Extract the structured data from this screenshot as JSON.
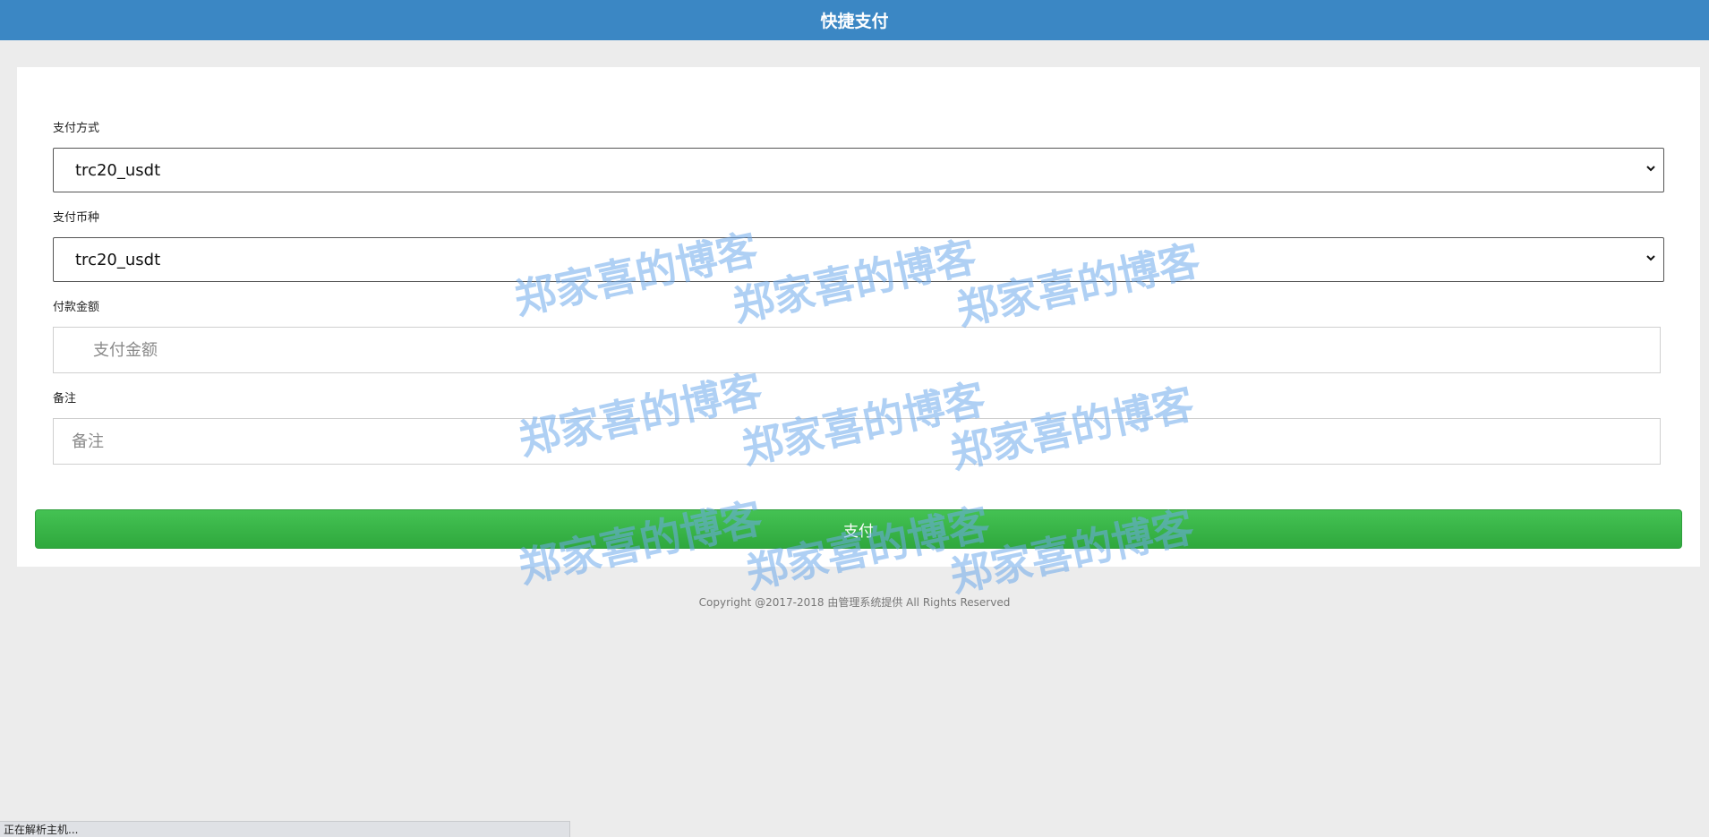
{
  "header": {
    "title": "快捷支付"
  },
  "form": {
    "pay_method": {
      "label": "支付方式",
      "value": "trc20_usdt"
    },
    "pay_currency": {
      "label": "支付币种",
      "value": "trc20_usdt"
    },
    "amount": {
      "label": "付款金额",
      "placeholder": "支付金额"
    },
    "remark": {
      "label": "备注",
      "placeholder": "备注"
    },
    "submit_label": "支付"
  },
  "footer": {
    "copyright": "Copyright @2017-2018 由管理系统提供 All Rights Reserved"
  },
  "watermark": {
    "text": "郑家喜的博客"
  },
  "status_bar": {
    "text": "正在解析主机..."
  },
  "colors": {
    "header": "#3b87c4",
    "button": "#3cb64a",
    "background": "#ececec",
    "watermark": "#6eaaeb"
  }
}
